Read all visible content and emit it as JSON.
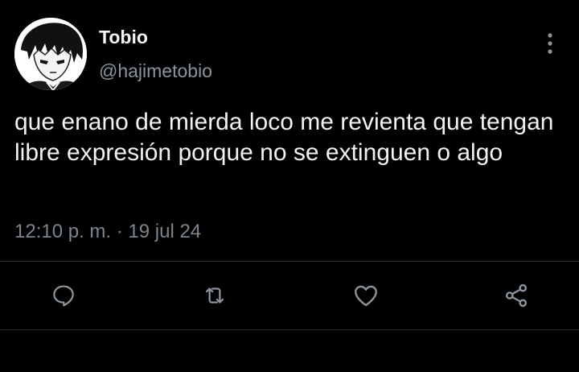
{
  "tweet": {
    "author": {
      "display_name": "Tobio",
      "handle": "@hajimetobio",
      "avatar_icon": "anime-avatar"
    },
    "text": "que enano de mierda loco me revienta que tengan libre expresión porque no se extinguen o algo",
    "timestamp": "12:10 p. m. · 19 jul 24"
  },
  "actions": [
    {
      "name": "reply",
      "icon": "reply-icon"
    },
    {
      "name": "retweet",
      "icon": "retweet-icon"
    },
    {
      "name": "like",
      "icon": "like-icon"
    },
    {
      "name": "share",
      "icon": "share-icon"
    }
  ],
  "more_icon": "more-vertical-icon",
  "colors": {
    "background": "#000000",
    "primary_text": "#f2f2f2",
    "secondary_text": "#7c858d",
    "icon": "#8b949c",
    "divider": "#2a2f33"
  }
}
